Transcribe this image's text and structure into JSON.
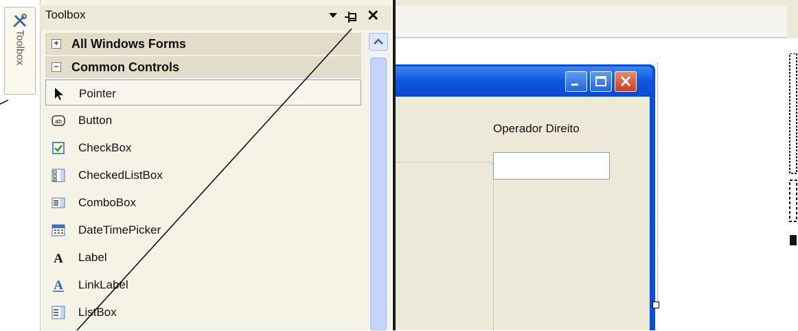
{
  "toolbox": {
    "tab_label": "Toolbox",
    "title": "Toolbox",
    "close_glyph": "✕",
    "groups": [
      {
        "label": "All Windows Forms",
        "expanded": false,
        "sign": "+"
      },
      {
        "label": "Common Controls",
        "expanded": true,
        "sign": "−"
      }
    ],
    "items": [
      {
        "label": "Pointer",
        "icon": "pointer-arrow-icon",
        "selected": true
      },
      {
        "label": "Button",
        "icon": "button-ab-icon"
      },
      {
        "label": "CheckBox",
        "icon": "checkbox-icon"
      },
      {
        "label": "CheckedListBox",
        "icon": "checkedlistbox-icon"
      },
      {
        "label": "ComboBox",
        "icon": "combobox-icon"
      },
      {
        "label": "DateTimePicker",
        "icon": "datetimepicker-icon"
      },
      {
        "label": "Label",
        "icon": "label-a-icon"
      },
      {
        "label": "LinkLabel",
        "icon": "linklabel-a-icon"
      },
      {
        "label": "ListBox",
        "icon": "listbox-icon"
      }
    ]
  },
  "form": {
    "operator_label": "Operador Direito",
    "operator_value": ""
  },
  "colors": {
    "titlebar": "#0c56de",
    "close_button": "#cf3c1b",
    "panel": "#f5f2e6"
  }
}
